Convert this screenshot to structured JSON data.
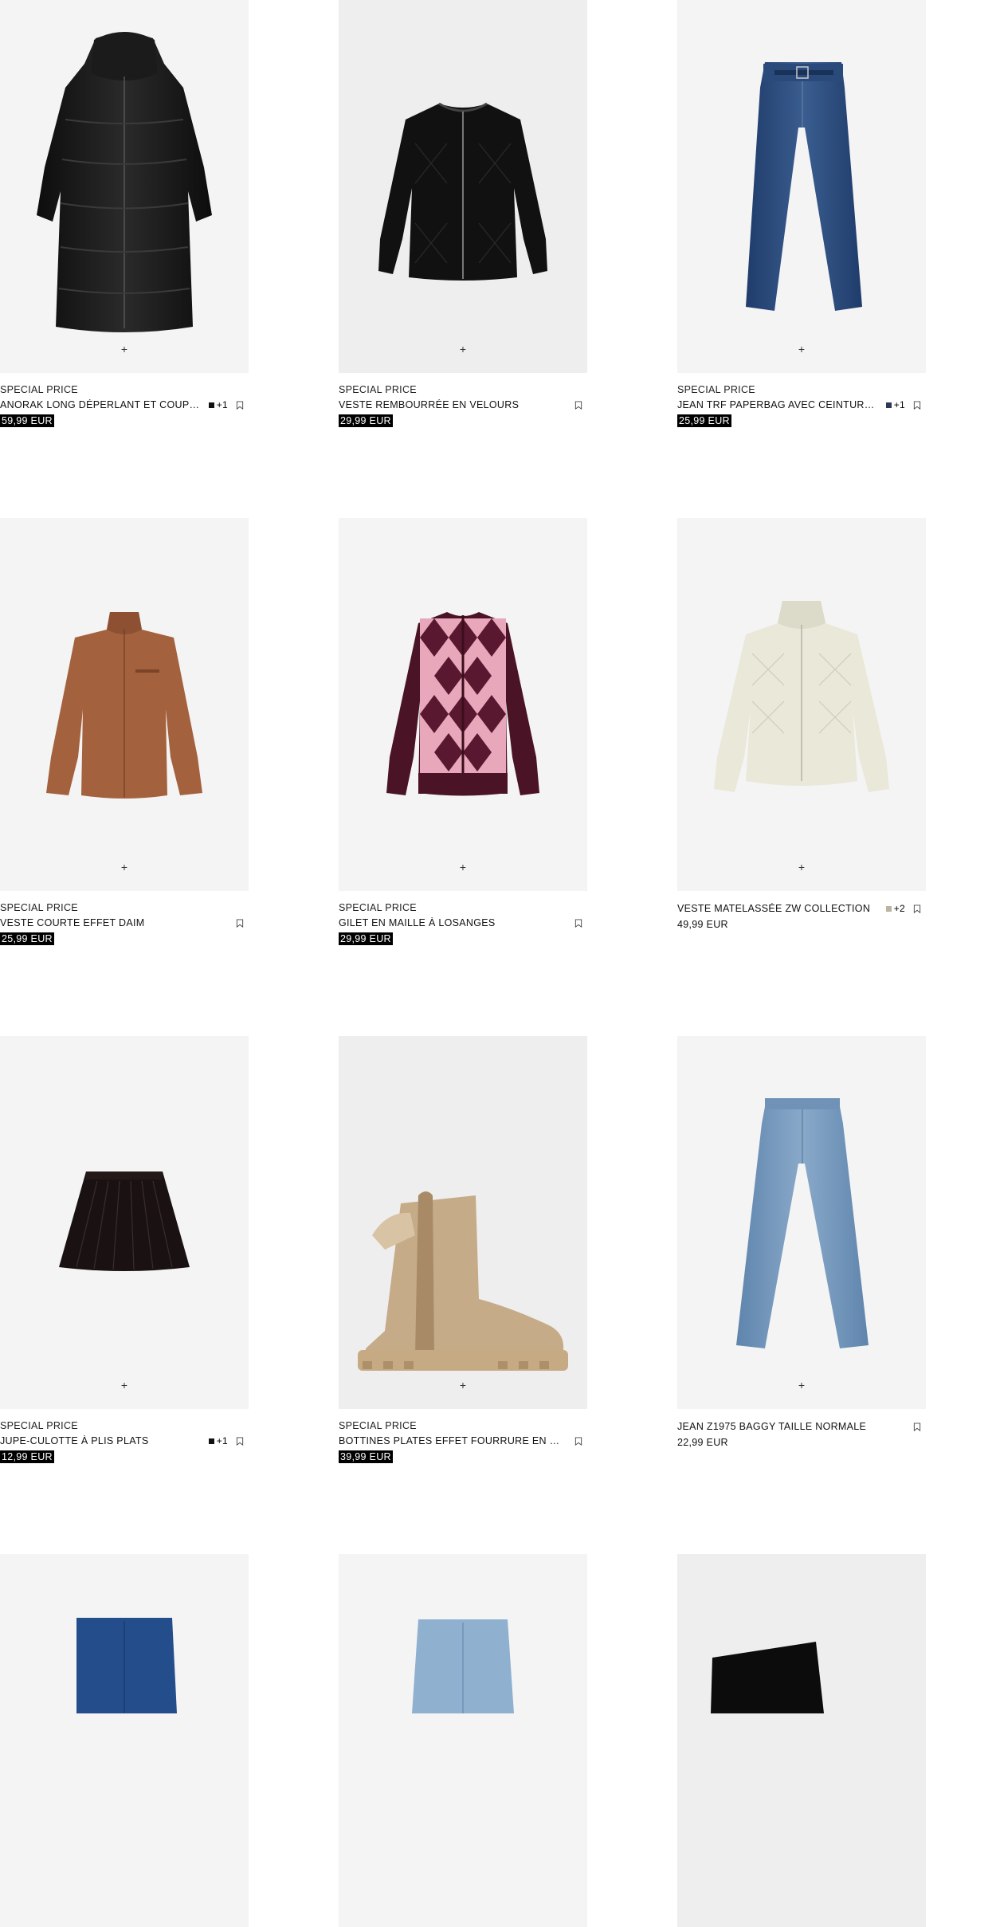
{
  "labels": {
    "plus": "+"
  },
  "products": [
    {
      "tag": "SPECIAL PRICE",
      "name": "ANORAK LONG DÉPERLANT ET COUPE...",
      "colors": {
        "swatch": "#111111",
        "more": "+1"
      },
      "price": "59,99 EUR",
      "sale": true,
      "image": "puffer-coat"
    },
    {
      "tag": "SPECIAL PRICE",
      "name": "VESTE REMBOURRÉE EN VELOURS",
      "colors": null,
      "price": "29,99 EUR",
      "sale": true,
      "image": "velvet-jacket"
    },
    {
      "tag": "SPECIAL PRICE",
      "name": "JEAN TRF PAPERBAG AVEC CEINTURE...",
      "colors": {
        "swatch": "#2b3a55",
        "more": "+1"
      },
      "price": "25,99 EUR",
      "sale": true,
      "image": "paperbag-jeans"
    },
    {
      "tag": "SPECIAL PRICE",
      "name": "VESTE COURTE EFFET DAIM",
      "colors": null,
      "price": "25,99 EUR",
      "sale": true,
      "image": "suede-jacket"
    },
    {
      "tag": "SPECIAL PRICE",
      "name": "GILET EN MAILLE À LOSANGES",
      "colors": null,
      "price": "29,99 EUR",
      "sale": true,
      "image": "argyle-cardigan"
    },
    {
      "tag": "",
      "name": "VESTE MATELASSÉE ZW COLLECTION",
      "colors": {
        "swatch": "#b9b5a2",
        "more": "+2"
      },
      "price": "49,99 EUR",
      "sale": false,
      "image": "quilted-jacket"
    },
    {
      "tag": "SPECIAL PRICE",
      "name": "JUPE-CULOTTE À PLIS PLATS",
      "colors": {
        "swatch": "#111111",
        "more": "+1"
      },
      "price": "12,99 EUR",
      "sale": true,
      "image": "pleated-skort"
    },
    {
      "tag": "SPECIAL PRICE",
      "name": "BOTTINES PLATES EFFET FOURRURE EN CR...",
      "colors": null,
      "price": "39,99 EUR",
      "sale": true,
      "image": "fur-boots"
    },
    {
      "tag": "",
      "name": "JEAN Z1975 BAGGY TAILLE NORMALE",
      "colors": null,
      "price": "22,99 EUR",
      "sale": false,
      "image": "baggy-jeans"
    },
    {
      "tag": "",
      "name": "",
      "colors": null,
      "price": "",
      "sale": false,
      "image": "dark-jeans"
    },
    {
      "tag": "",
      "name": "",
      "colors": null,
      "price": "",
      "sale": false,
      "image": "light-jeans"
    },
    {
      "tag": "",
      "name": "",
      "colors": null,
      "price": "",
      "sale": false,
      "image": "black-boot"
    }
  ]
}
